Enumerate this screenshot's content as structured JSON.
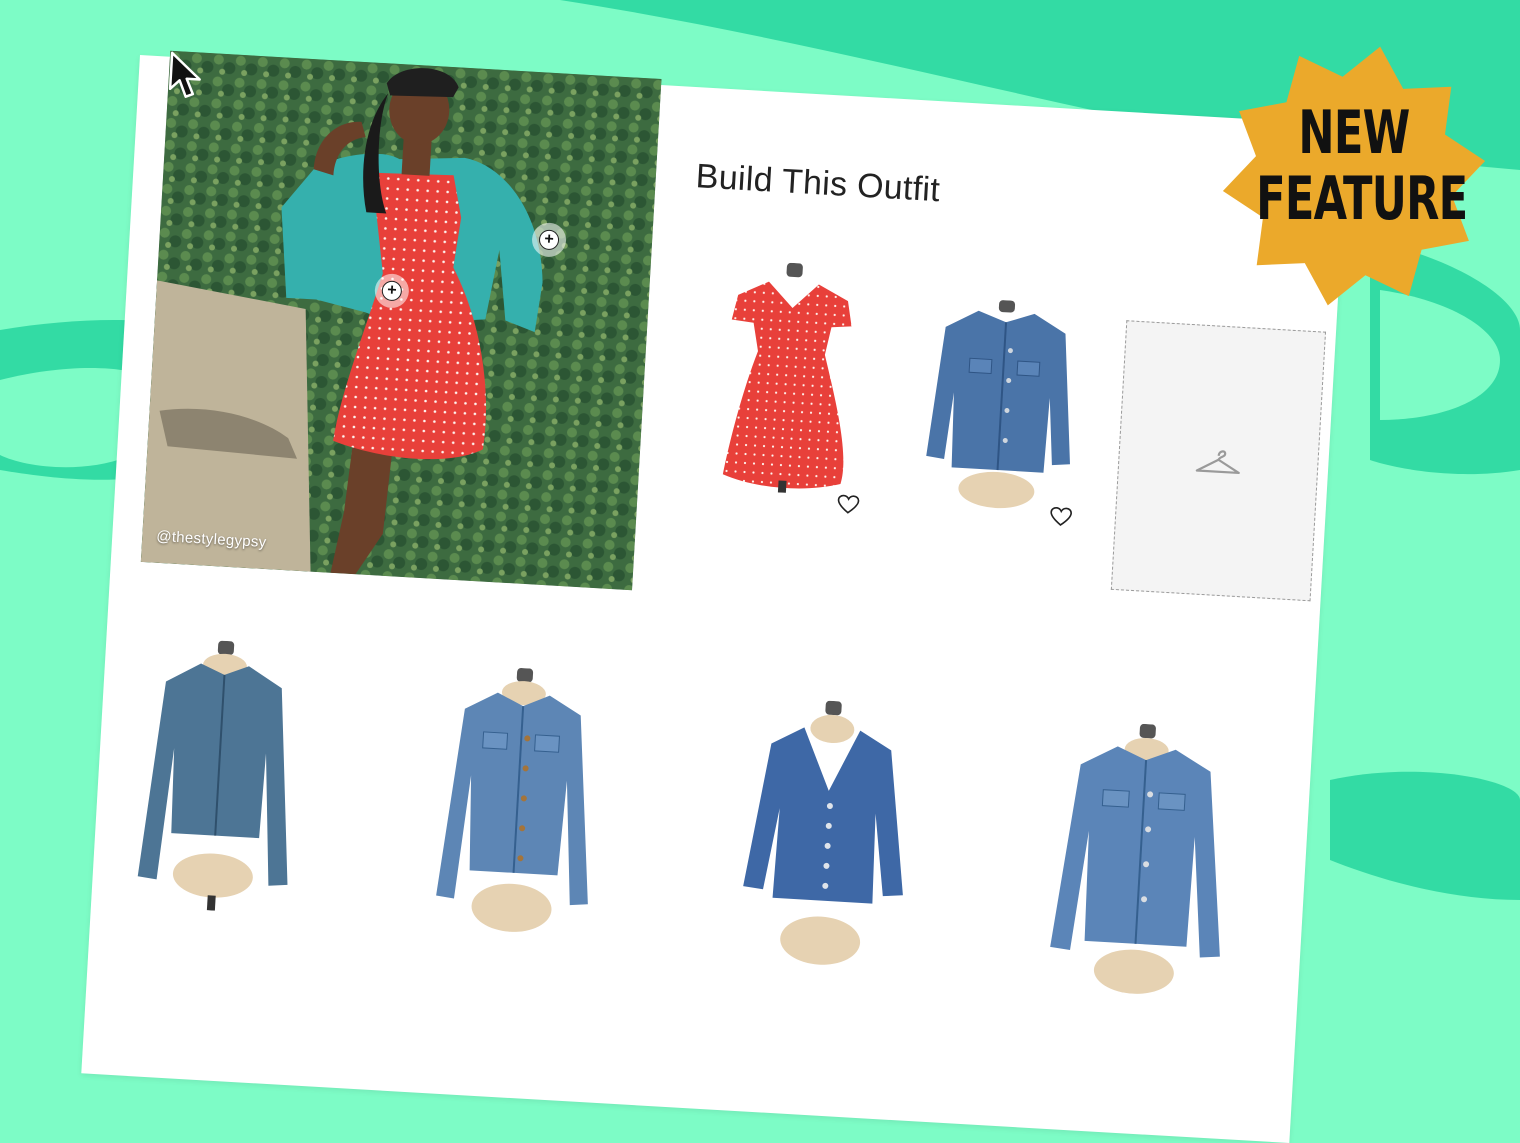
{
  "page": {
    "title": "Build This Outfit",
    "photo_credit": "@thestylegypsy"
  },
  "badge": {
    "line1": "NEW",
    "line2": "FEATURE",
    "color": "#eba92b"
  },
  "colors": {
    "background": "#7dfcc6",
    "wave": "#33dba4",
    "card": "#ffffff",
    "dress": "#e8403a",
    "denim": "#3f6aa0"
  },
  "hotspots": [
    {
      "name": "dress",
      "icon": "plus-icon"
    },
    {
      "name": "jacket",
      "icon": "plus-icon"
    }
  ],
  "outfit_items": [
    {
      "name": "red-polka-dot-wrap-dress",
      "favorite_icon": "heart-outline-icon"
    },
    {
      "name": "denim-jacket",
      "favorite_icon": "heart-outline-icon"
    },
    {
      "name": "empty-slot",
      "icon": "hanger-icon"
    }
  ],
  "recommendations": [
    {
      "name": "denim-zip-jacket"
    },
    {
      "name": "denim-button-jacket"
    },
    {
      "name": "denim-v-neck-jacket"
    },
    {
      "name": "denim-oversized-jacket"
    }
  ]
}
